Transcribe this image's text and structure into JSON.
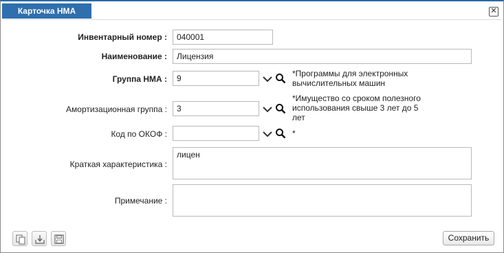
{
  "window": {
    "tab_title": "Карточка НМА",
    "close_glyph": "✕"
  },
  "fields": {
    "inventory_number": {
      "label": "Инвентарный номер :",
      "value": "040001"
    },
    "name": {
      "label": "Наименование :",
      "value": "Лицензия"
    },
    "nma_group": {
      "label": "Группа НМА :",
      "value": "9",
      "hint": "*Программы для электронных вычислительных машин"
    },
    "amortization_group": {
      "label": "Амортизационная группа :",
      "value": "3",
      "hint": "*Имущество со сроком полезного использования свыше 3 лет до 5 лет"
    },
    "okof_code": {
      "label": "Код по ОКОФ :",
      "value": "",
      "hint": "*"
    },
    "short_description": {
      "label": "Краткая характеристика :",
      "value": "лицен"
    },
    "note": {
      "label": "Примечание :",
      "value": ""
    }
  },
  "footer": {
    "icons": [
      "copy-icon",
      "import-icon",
      "save-disk-icon"
    ],
    "save_label": "Сохранить"
  },
  "colors": {
    "tab_background": "#2f6fae",
    "tab_text": "#ffffff",
    "border": "#b9b9b9"
  }
}
